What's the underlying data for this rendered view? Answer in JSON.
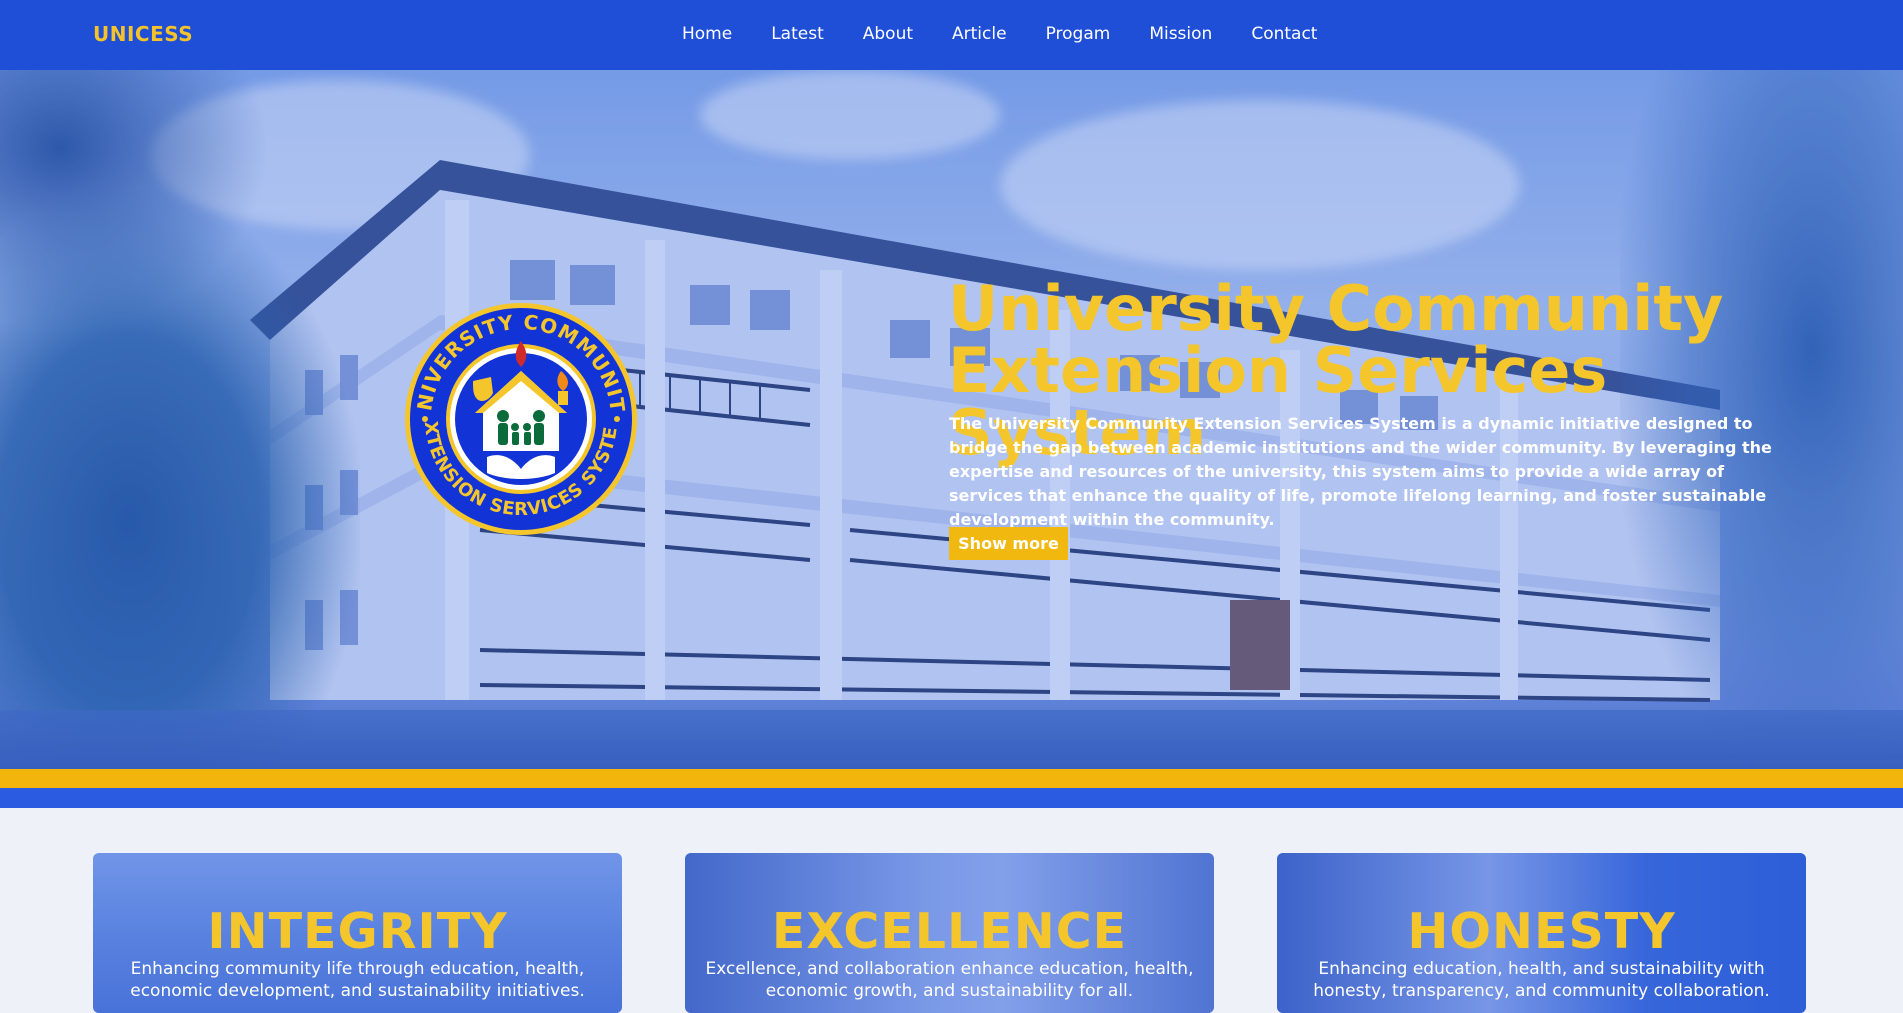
{
  "navbar": {
    "brand": "UNICESS",
    "links": [
      {
        "label": "Home"
      },
      {
        "label": "Latest"
      },
      {
        "label": "About"
      },
      {
        "label": "Article"
      },
      {
        "label": "Progam"
      },
      {
        "label": "Mission"
      },
      {
        "label": "Contact"
      }
    ]
  },
  "hero": {
    "title": "University Community Extension Services System",
    "description": "The University Community Extension Services System is a dynamic initiative designed to bridge the gap between academic institutions and the wider community. By leveraging the expertise and resources of the university, this system aims to provide a wide array of services that enhance the quality of life, promote lifelong learning, and foster sustainable development within the community.",
    "button_label": "Show more",
    "seal": {
      "top_text": "UNIVERSITY COMMUNITY",
      "bottom_text": "EXTENSION SERVICES SYSTEM"
    }
  },
  "cards": [
    {
      "title": "INTEGRITY",
      "text": "Enhancing community life through education, health, economic development, and sustainability initiatives."
    },
    {
      "title": "EXCELLENCE",
      "text": "Excellence, and collaboration enhance education, health, economic growth, and sustainability for all."
    },
    {
      "title": "HONESTY",
      "text": "Enhancing education, health, and sustainability with honesty, transparency, and community collaboration."
    }
  ],
  "colors": {
    "nav_bg": "#1f4fd6",
    "accent_gold": "#f5c62b",
    "button_gold": "#f1b90f",
    "stripe_blue": "#2a5be0"
  }
}
